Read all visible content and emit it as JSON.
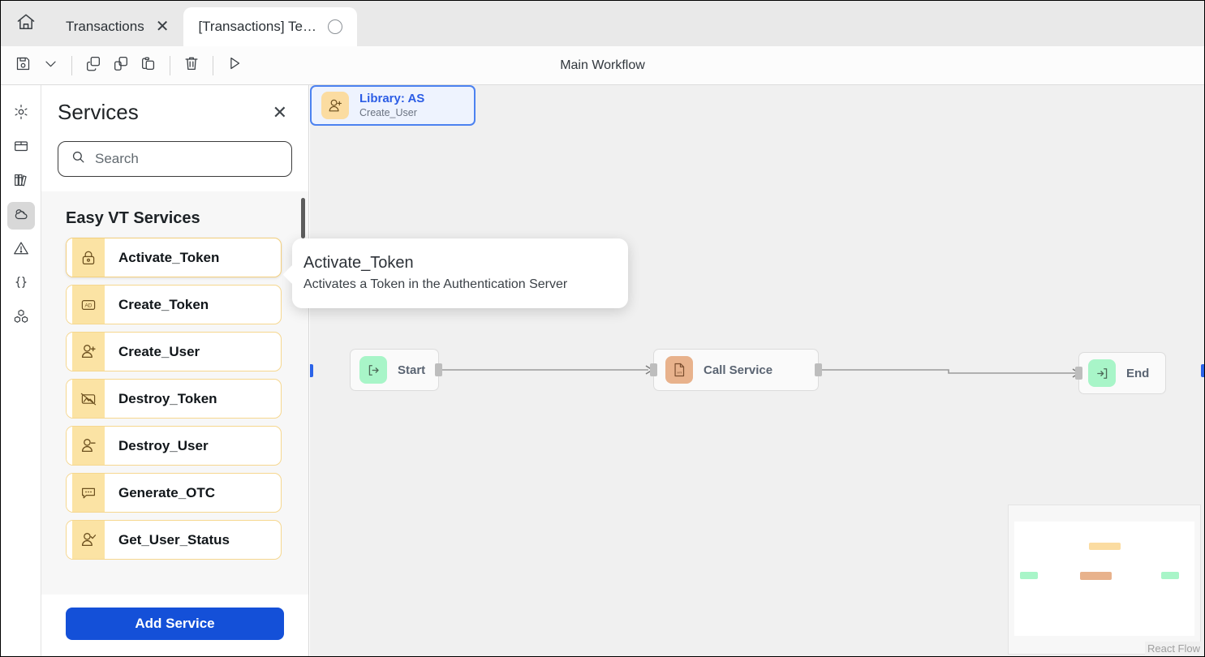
{
  "tabs": [
    {
      "label": "Transactions",
      "active": false,
      "icon": "close-icon"
    },
    {
      "label": "[Transactions] Te…",
      "active": true,
      "icon": "spinner-icon"
    }
  ],
  "home": {
    "icon": "home-icon"
  },
  "toolbar": {
    "save_label": "Save",
    "dropdown_label": "Save options",
    "copy_label": "Copy",
    "duplicate_label": "Duplicate",
    "paste_label": "Paste",
    "delete_label": "Delete",
    "run_label": "Run"
  },
  "workflow": {
    "title": "Main Workflow"
  },
  "rail": {
    "items": [
      {
        "name": "settings",
        "icon": "gear-icon",
        "selected": false
      },
      {
        "name": "package",
        "icon": "box-icon",
        "selected": false
      },
      {
        "name": "libraries",
        "icon": "books-icon",
        "selected": false
      },
      {
        "name": "services",
        "icon": "clouds-icon",
        "selected": true
      },
      {
        "name": "errors",
        "icon": "warning-triangle-icon",
        "selected": false
      },
      {
        "name": "variables",
        "icon": "curly-braces-icon",
        "selected": false
      },
      {
        "name": "components",
        "icon": "cubes-icon",
        "selected": false
      }
    ]
  },
  "panel": {
    "title": "Services",
    "close_icon": "close-icon",
    "search": {
      "placeholder": "Search",
      "value": "",
      "icon": "search-icon"
    },
    "group_title": "Easy VT Services",
    "services": [
      {
        "label": "Activate_Token",
        "icon": "lock-icon",
        "active": true
      },
      {
        "label": "Create_Token",
        "icon": "ad-badge-icon",
        "active": false
      },
      {
        "label": "Create_User",
        "icon": "user-plus-icon",
        "active": false
      },
      {
        "label": "Destroy_Token",
        "icon": "image-slash-icon",
        "active": false
      },
      {
        "label": "Destroy_User",
        "icon": "user-minus-icon",
        "active": false
      },
      {
        "label": "Generate_OTC",
        "icon": "chat-dots-icon",
        "active": false
      },
      {
        "label": "Get_User_Status",
        "icon": "user-check-icon",
        "active": false
      }
    ],
    "add_button": "Add Service"
  },
  "tooltip": {
    "title": "Activate_Token",
    "description": "Activates a Token in the Authentication Server"
  },
  "canvas": {
    "attribution": "React Flow",
    "nodes": [
      {
        "id": "library-as",
        "kind": "selected-library",
        "title": "Library: AS",
        "subtitle": "Create_User",
        "icon": "user-plus-icon",
        "icon_color": "amber"
      },
      {
        "id": "start",
        "kind": "simple",
        "label": "Start",
        "icon": "arrow-enter-icon",
        "icon_color": "green"
      },
      {
        "id": "call-service",
        "kind": "simple",
        "label": "Call Service",
        "icon": "xml-file-icon",
        "icon_color": "salmon"
      },
      {
        "id": "end",
        "kind": "simple",
        "label": "End",
        "icon": "arrow-exit-icon",
        "icon_color": "green"
      }
    ]
  },
  "minimap": {
    "nodes": [
      {
        "id": "library-as",
        "color": "#fbdca1"
      },
      {
        "id": "start",
        "color": "#a8f5c8"
      },
      {
        "id": "call-service",
        "color": "#e8b28c"
      },
      {
        "id": "end",
        "color": "#a8f5c8"
      }
    ]
  },
  "colors": {
    "accent_blue": "#1450d8",
    "node_selected_border": "#4c82f0",
    "node_selected_fill": "#eef3fe",
    "service_icon_bg": "#fbe3a4",
    "service_border": "#f6d78f",
    "canvas_bg": "#f0f0f0"
  }
}
